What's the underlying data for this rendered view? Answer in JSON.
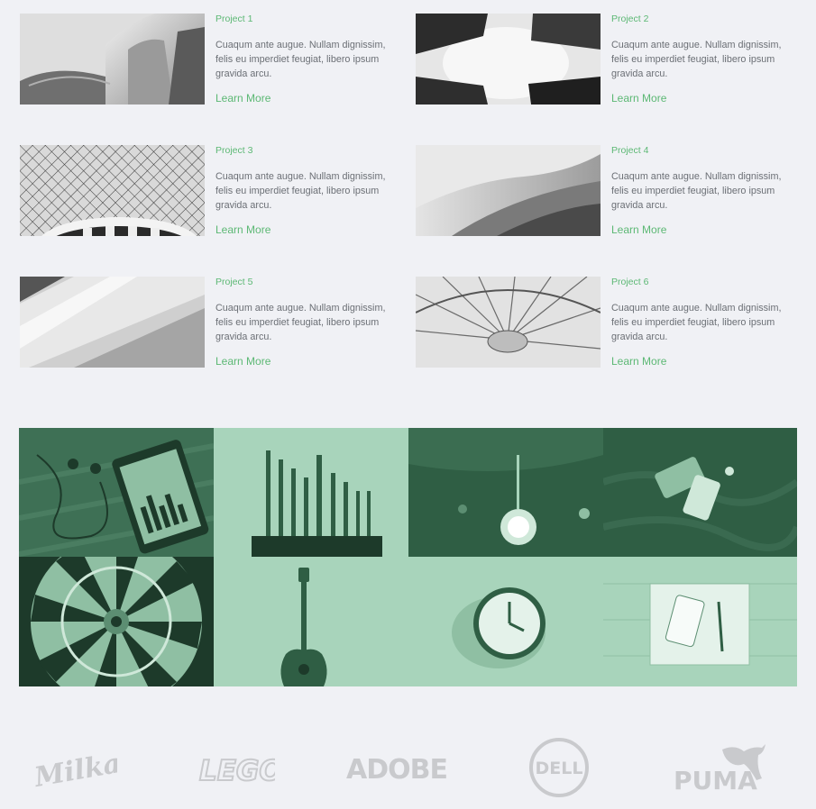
{
  "projects": [
    {
      "title": "Project 1",
      "description": "Cuaqum ante augue. Nullam dignissim, felis eu imperdiet feugiat, libero ipsum gravida arcu.",
      "link": "Learn More",
      "image": "architecture-curves-photo"
    },
    {
      "title": "Project 2",
      "description": "Cuaqum ante augue. Nullam dignissim, felis eu imperdiet feugiat, libero ipsum gravida arcu.",
      "link": "Learn More",
      "image": "buildings-sky-photo"
    },
    {
      "title": "Project 3",
      "description": "Cuaqum ante augue. Nullam dignissim, felis eu imperdiet feugiat, libero ipsum gravida arcu.",
      "link": "Learn More",
      "image": "glass-dome-photo"
    },
    {
      "title": "Project 4",
      "description": "Cuaqum ante augue. Nullam dignissim, felis eu imperdiet feugiat, libero ipsum gravida arcu.",
      "link": "Learn More",
      "image": "wave-facade-photo"
    },
    {
      "title": "Project 5",
      "description": "Cuaqum ante augue. Nullam dignissim, felis eu imperdiet feugiat, libero ipsum gravida arcu.",
      "link": "Learn More",
      "image": "diagonal-facade-photo"
    },
    {
      "title": "Project 6",
      "description": "Cuaqum ante augue. Nullam dignissim, felis eu imperdiet feugiat, libero ipsum gravida arcu.",
      "link": "Learn More",
      "image": "ferris-wheel-photo"
    }
  ],
  "gallery": [
    {
      "name": "phone-headphones-photo",
      "tint": "dark"
    },
    {
      "name": "drill-bits-photo",
      "tint": "light"
    },
    {
      "name": "light-bulb-photo",
      "tint": "dark"
    },
    {
      "name": "phones-on-fabric-photo",
      "tint": "dark"
    },
    {
      "name": "dartboard-photo",
      "tint": "dark"
    },
    {
      "name": "guitar-photo",
      "tint": "light"
    },
    {
      "name": "wall-clock-photo",
      "tint": "light"
    },
    {
      "name": "notebook-phone-photo",
      "tint": "light"
    }
  ],
  "brands": [
    {
      "name": "Milka",
      "logo": "milka-logo"
    },
    {
      "name": "LEGO",
      "logo": "lego-logo"
    },
    {
      "name": "ADOBE",
      "logo": "adobe-logo"
    },
    {
      "name": "DELL",
      "logo": "dell-logo"
    },
    {
      "name": "PUMA",
      "logo": "puma-logo"
    }
  ],
  "colors": {
    "accent": "#5cb874",
    "background": "#f0f1f5",
    "text": "#6b6f75",
    "tint_dark": "#2f5e44",
    "tint_light": "#a8d4bb",
    "logo": "#c9cacd"
  }
}
